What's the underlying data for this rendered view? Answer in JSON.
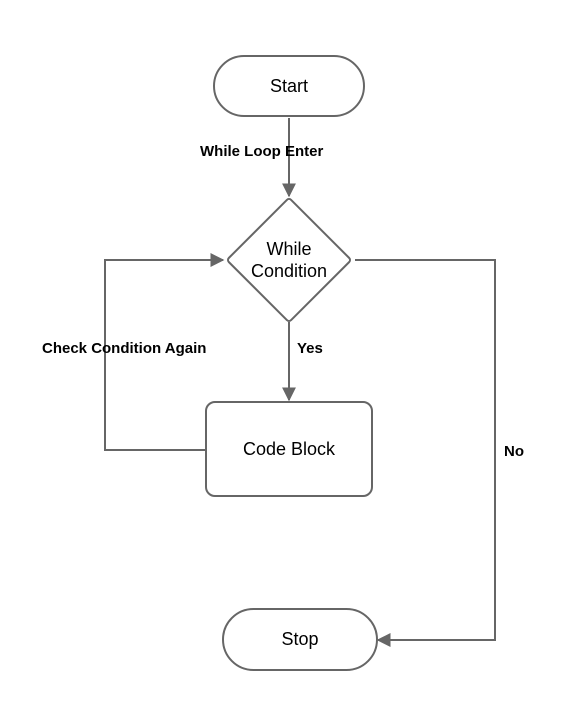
{
  "nodes": {
    "start": "Start",
    "condition": "While\nCondition",
    "code_block": "Code Block",
    "stop": "Stop"
  },
  "edges": {
    "enter": "While Loop Enter",
    "yes": "Yes",
    "no": "No",
    "check_again": "Check Condition Again"
  },
  "chart_data": {
    "type": "flowchart",
    "title": "While Loop Flowchart",
    "nodes": [
      {
        "id": "start",
        "type": "terminal",
        "label": "Start"
      },
      {
        "id": "condition",
        "type": "decision",
        "label": "While Condition"
      },
      {
        "id": "code_block",
        "type": "process",
        "label": "Code Block"
      },
      {
        "id": "stop",
        "type": "terminal",
        "label": "Stop"
      }
    ],
    "edges": [
      {
        "from": "start",
        "to": "condition",
        "label": "While Loop Enter"
      },
      {
        "from": "condition",
        "to": "code_block",
        "label": "Yes"
      },
      {
        "from": "condition",
        "to": "stop",
        "label": "No"
      },
      {
        "from": "code_block",
        "to": "condition",
        "label": "Check Condition Again"
      }
    ]
  }
}
